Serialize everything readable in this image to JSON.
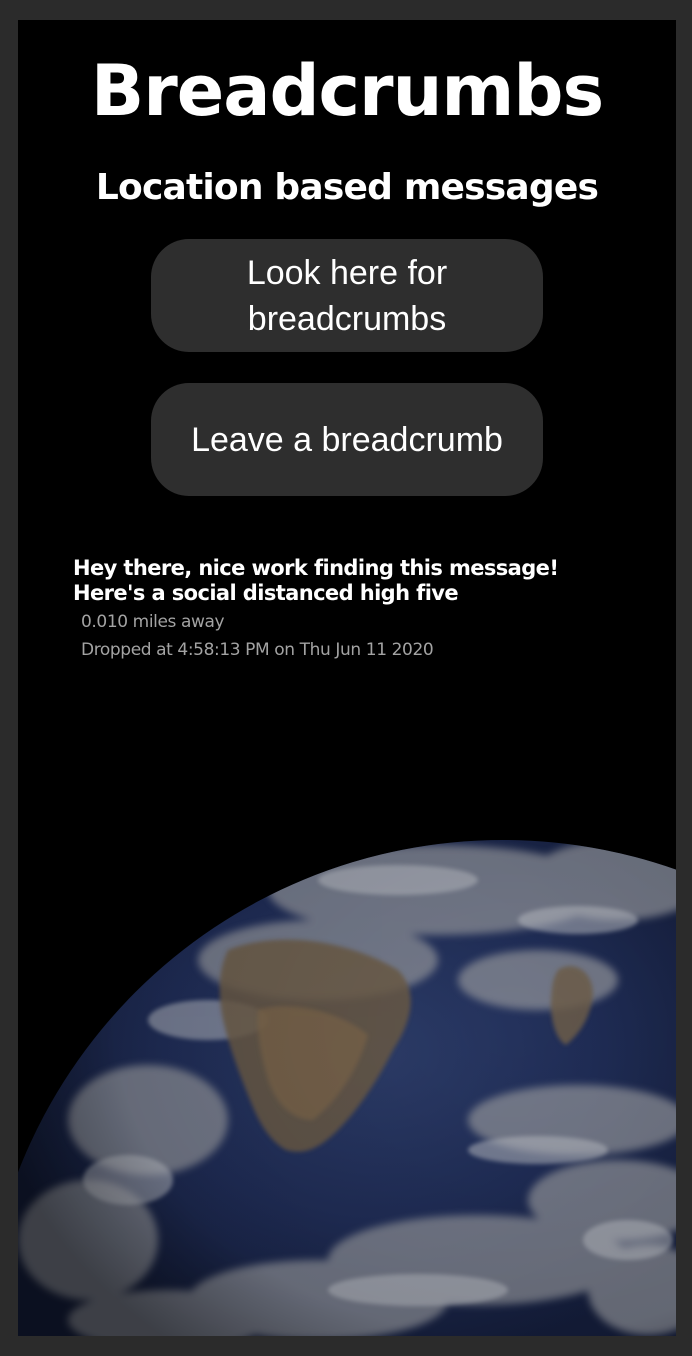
{
  "app": {
    "title": "Breadcrumbs",
    "subtitle": "Location based messages"
  },
  "actions": {
    "look_label": "Look here for breadcrumbs",
    "leave_label": "Leave a breadcrumb"
  },
  "message": {
    "text_line1": "Hey there, nice work finding this message!",
    "text_line2": "Here's a social distanced high five",
    "distance": "0.010 miles away",
    "dropped": "Dropped at 4:58:13 PM on Thu Jun 11 2020"
  },
  "background": {
    "image": "earth-from-space",
    "color": "#000000",
    "button_color": "#2e2e2e",
    "meta_color": "#a3a3a3"
  }
}
